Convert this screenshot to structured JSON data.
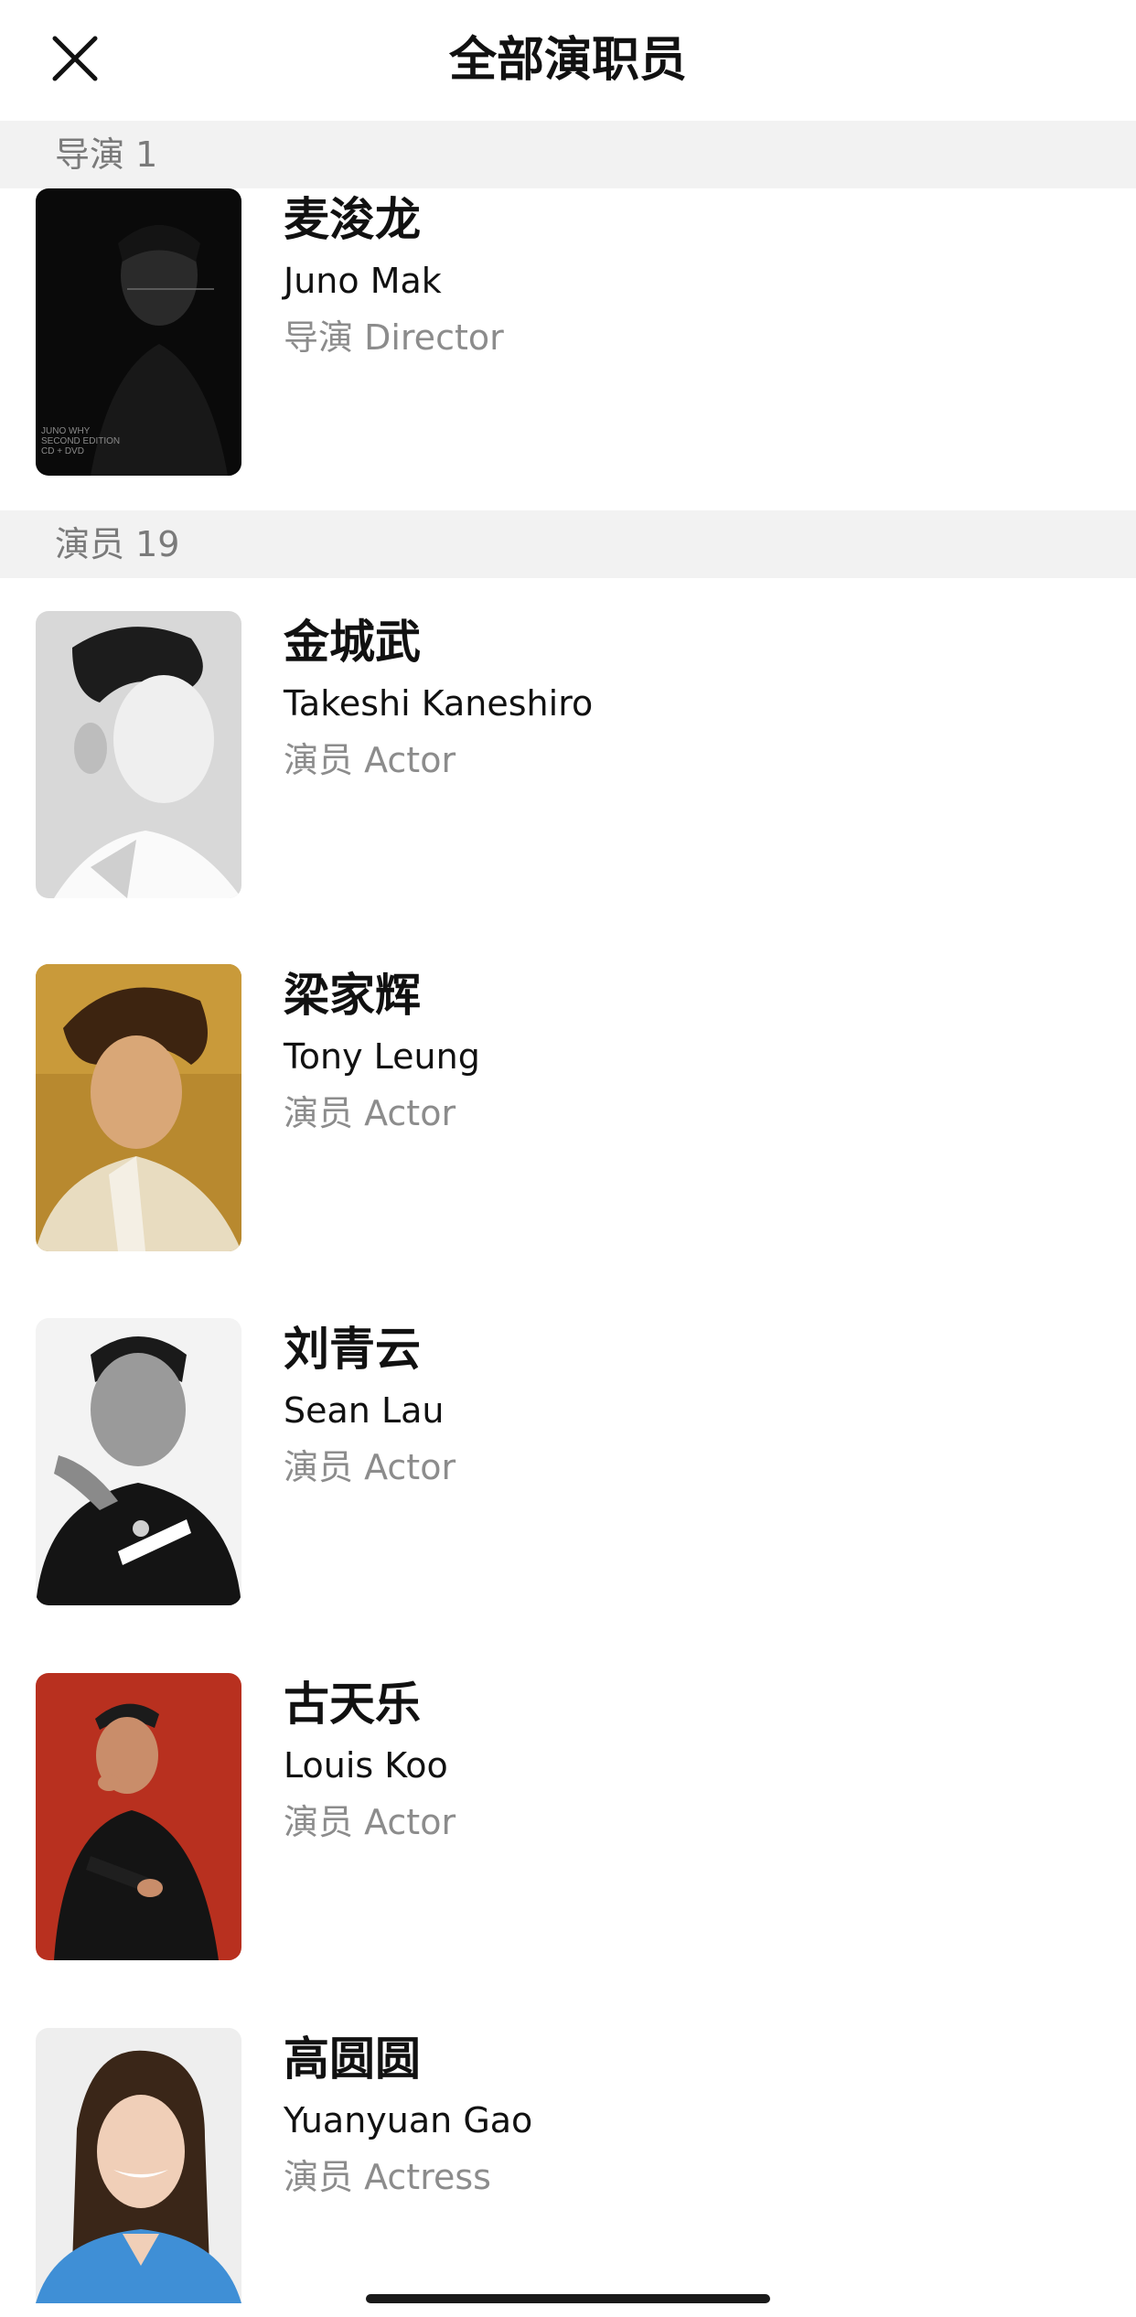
{
  "header": {
    "title": "全部演职员",
    "close_icon": "close-icon"
  },
  "sections": [
    {
      "label": "导演 1",
      "people": [
        {
          "name_cn": "麦浚龙",
          "name_en": "Juno Mak",
          "role": "导演 Director",
          "cover_text": "JUNO WHY\nSECOND EDITION\nCD + DVD"
        }
      ]
    },
    {
      "label": "演员 19",
      "people": [
        {
          "name_cn": "金城武",
          "name_en": "Takeshi Kaneshiro",
          "role": "演员 Actor"
        },
        {
          "name_cn": "梁家辉",
          "name_en": "Tony Leung",
          "role": "演员 Actor"
        },
        {
          "name_cn": "刘青云",
          "name_en": "Sean Lau",
          "role": "演员 Actor"
        },
        {
          "name_cn": "古天乐",
          "name_en": "Louis Koo",
          "role": "演员 Actor"
        },
        {
          "name_cn": "高圆圆",
          "name_en": "Yuanyuan Gao",
          "role": "演员 Actress"
        }
      ]
    }
  ]
}
